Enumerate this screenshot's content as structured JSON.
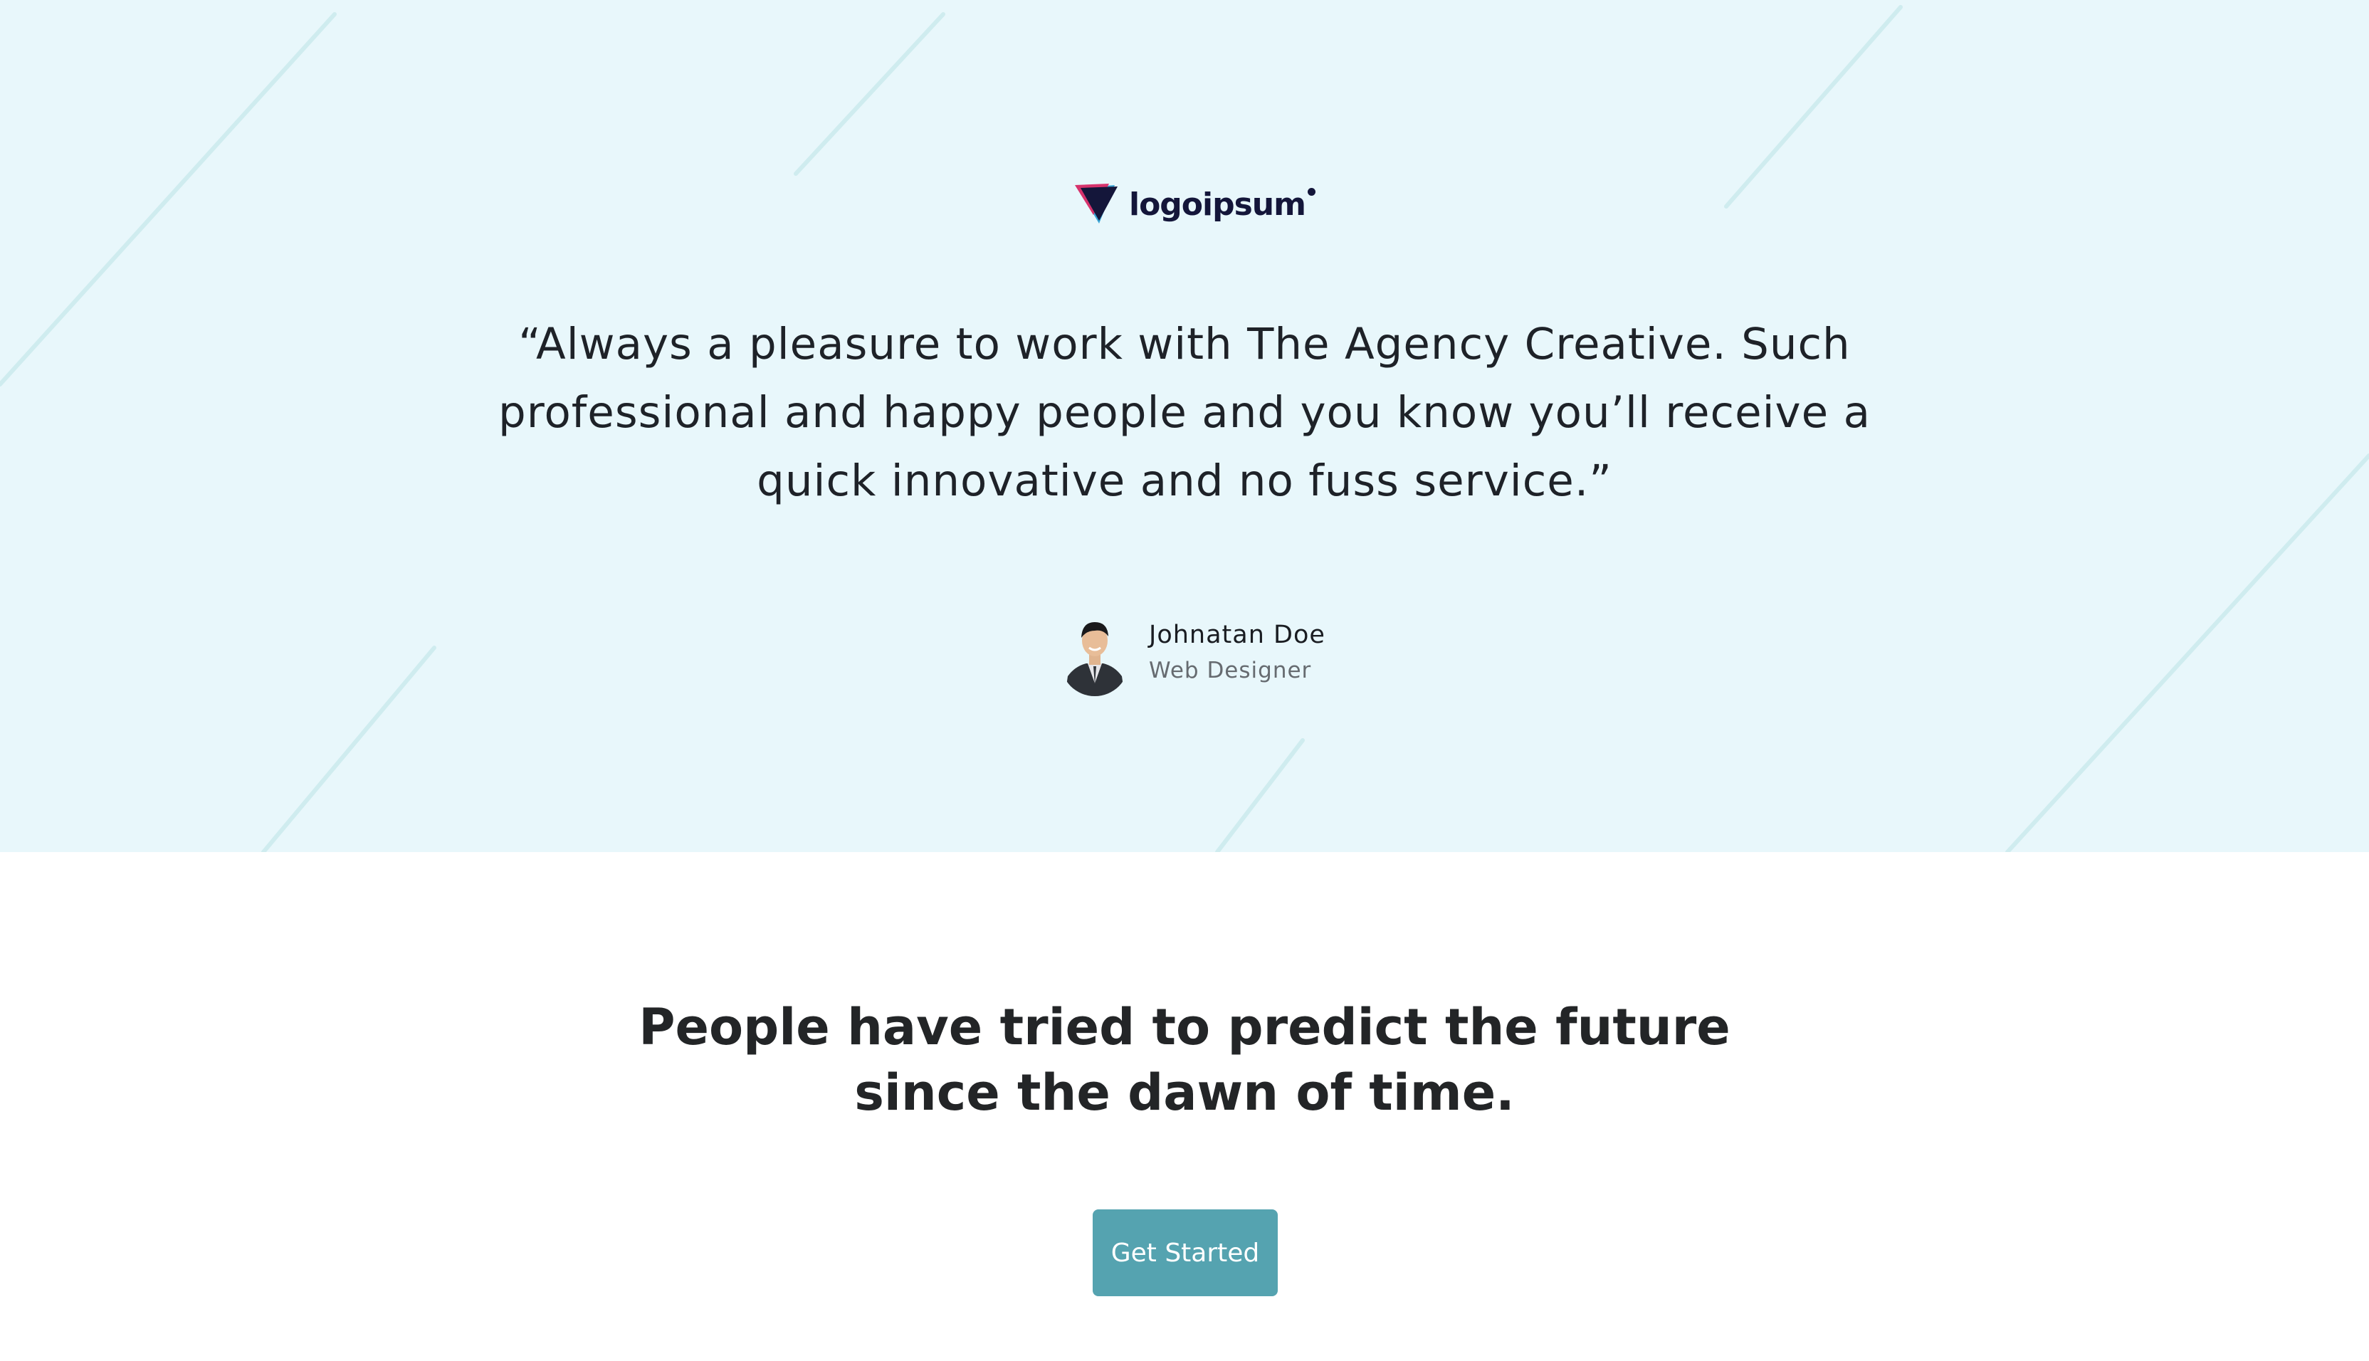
{
  "colors": {
    "testimonial_bg": "#e8f7fb",
    "deco_line": "#cfecef",
    "logo_navy": "#14163a",
    "logo_pink": "#d6336c",
    "logo_blue": "#3aa6d6",
    "text_dark": "#1e2228",
    "text_muted": "#666b70",
    "button_bg": "#55a3b0",
    "button_text": "#ffffff"
  },
  "logo": {
    "text": "logoipsum",
    "icon": "logo-mark-icon"
  },
  "testimonial": {
    "quote": "“Always a pleasure to work with The Agency Creative. Such professional and happy people and you know you’ll receive a quick innovative and no fuss service.”",
    "author": {
      "name": "Johnatan Doe",
      "role": "Web Designer",
      "avatar_icon": "avatar-photo"
    }
  },
  "cta": {
    "heading": "People have tried to predict the future\nsince the dawn of time.",
    "button_label": "Get Started"
  }
}
